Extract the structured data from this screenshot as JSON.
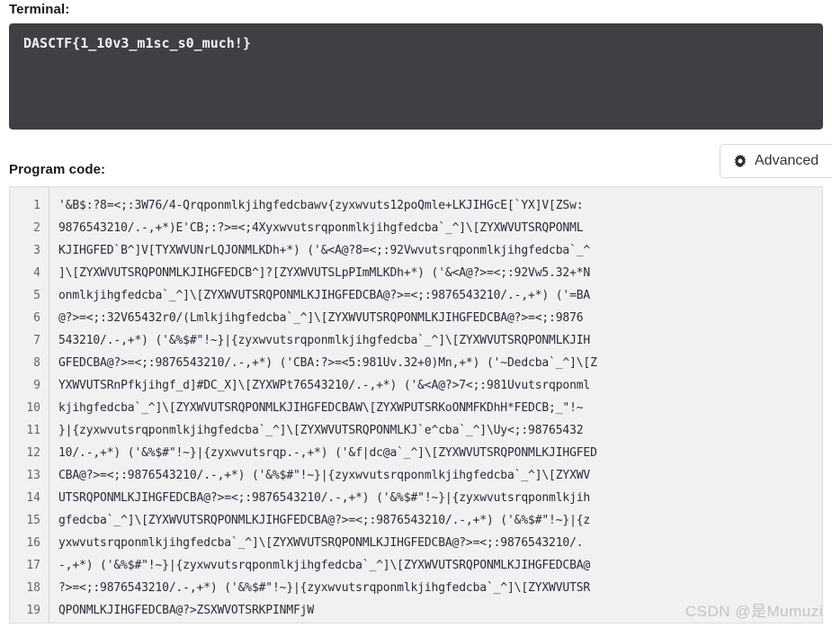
{
  "terminal": {
    "label": "Terminal:",
    "output": "DASCTF{1_10v3_m1sc_s0_much!}",
    "background_color": "#3f4044",
    "text_color": "#f4f4f4"
  },
  "program_code": {
    "label": "Program code:",
    "advanced_button": {
      "label": "Advanced",
      "icon": "gear-icon"
    },
    "editor": {
      "background_color": "#f1f1f1",
      "line_numbers": [
        1,
        2,
        3,
        4,
        5,
        6,
        7,
        8,
        9,
        10,
        11,
        12,
        13,
        14,
        15,
        16,
        17,
        18,
        19
      ],
      "lines": [
        "'&B$:?8=<;:3W76/4-Qrqponmlkjihgfedcbawv{zyxwvuts12poQmle+LKJIHGcE[`YX]V[ZSw:",
        "9876543210/.-,+*)E'CB;:?>=<;4Xyxwvutsrqponmlkjihgfedcba`_^]\\[ZYXWVUTSRQPONML",
        "KJIHGFED`B^]V[TYXWVUNrLQJONMLKDh+*) ('&<A@?8=<;:92Vwvutsrqponmlkjihgfedcba`_^",
        "]\\[ZYXWVUTSRQPONMLKJIHGFEDCB^]?[ZYXWVUTSLpPImMLKDh+*) ('&<A@?>=<;:92Vw5.32+*N",
        "onmlkjihgfedcba`_^]\\[ZYXWVUTSRQPONMLKJIHGFEDCBA@?>=<;:9876543210/.-,+*) ('=BA",
        "@?>=<;:32V65432r0/(Lmlkjihgfedcba`_^]\\[ZYXWVUTSRQPONMLKJIHGFEDCBA@?>=<;:9876",
        "543210/.-,+*) ('&%$#\"!~}|{zyxwvutsrqponmlkjihgfedcba`_^]\\[ZYXWVUTSRQPONMLKJIH",
        "GFEDCBA@?>=<;:9876543210/.-,+*) ('CBA:?>=<5:981Uv.32+0)Mn,+*) ('~Dedcba`_^]\\[Z",
        "YXWVUTSRnPfkjihgf_d]#DC_X]\\[ZYXWPt76543210/.-,+*) ('&<A@?>7<;:981Uvutsrqponml",
        "kjihgfedcba`_^]\\[ZYXWVUTSRQPONMLKJIHGFEDCBAW\\[ZYXWPUTSRKoONMFKDhH*FEDCB;_\"!~",
        "}|{zyxwvutsrqponmlkjihgfedcba`_^]\\[ZYXWVUTSRQPONMLKJ`e^cba`_^]\\Uy<;:98765432",
        "10/.-,+*) ('&%$#\"!~}|{zyxwvutsrqp.-,+*) ('&f|dc@a`_^]\\[ZYXWVUTSRQPONMLKJIHGFED",
        "CBA@?>=<;:9876543210/.-,+*) ('&%$#\"!~}|{zyxwvutsrqponmlkjihgfedcba`_^]\\[ZYXWV",
        "UTSRQPONMLKJIHGFEDCBA@?>=<;:9876543210/.-,+*) ('&%$#\"!~}|{zyxwvutsrqponmlkjih",
        "gfedcba`_^]\\[ZYXWVUTSRQPONMLKJIHGFEDCBA@?>=<;:9876543210/.-,+*) ('&%$#\"!~}|{z",
        "yxwvutsrqponmlkjihgfedcba`_^]\\[ZYXWVUTSRQPONMLKJIHGFEDCBA@?>=<;:9876543210/.",
        "-,+*) ('&%$#\"!~}|{zyxwvutsrqponmlkjihgfedcba`_^]\\[ZYXWVUTSRQPONMLKJIHGFEDCBA@",
        "?>=<;:9876543210/.-,+*) ('&%$#\"!~}|{zyxwvutsrqponmlkjihgfedcba`_^]\\[ZYXWVUTSR",
        "QPONMLKJIHGFEDCBA@?>ZSXWVOTSRKPINMFjW"
      ]
    }
  },
  "watermark": {
    "text": "CSDN @是Mumuzi"
  }
}
